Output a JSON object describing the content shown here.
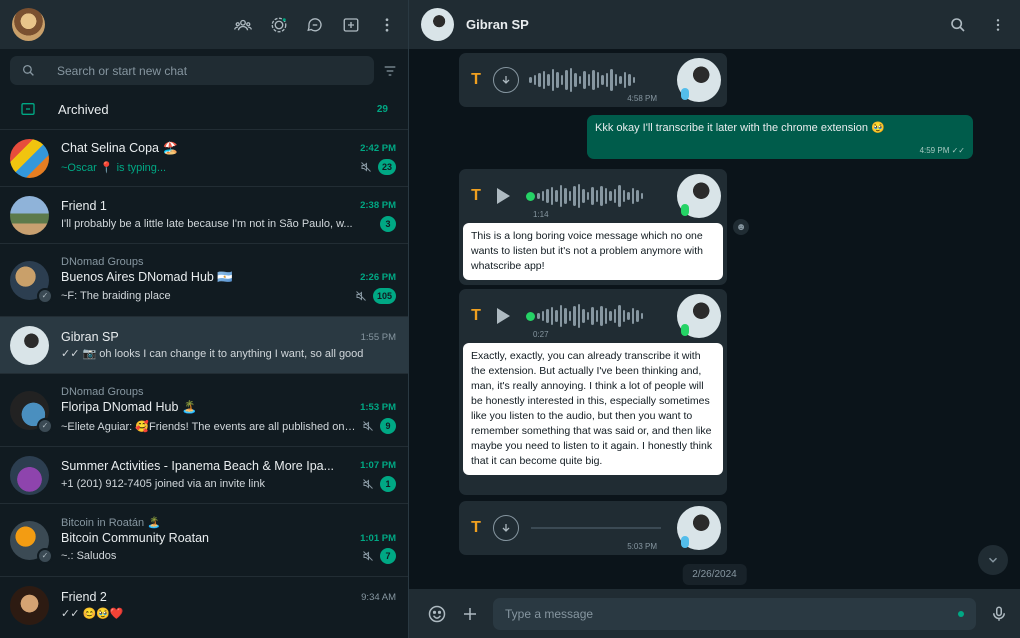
{
  "left_header": {
    "icons": [
      "communities-icon",
      "status-icon",
      "channels-icon",
      "new-chat-icon",
      "menu-icon"
    ]
  },
  "search": {
    "placeholder": "Search or start new chat"
  },
  "archived": {
    "label": "Archived",
    "count": "29"
  },
  "chats": [
    {
      "group": "",
      "name": "Chat Selina Copa 🏖️",
      "time": "2:42 PM",
      "time_green": true,
      "preview": "~Oscar 📍 is typing...",
      "preview_green": true,
      "muted": true,
      "badge": "23"
    },
    {
      "group": "",
      "name": "Friend 1",
      "time": "2:38 PM",
      "time_green": true,
      "preview": "I'll probably be a little late because I'm not in São Paulo, w...",
      "preview_green": false,
      "muted": false,
      "badge": "3"
    },
    {
      "group": "DNomad Groups",
      "name": "Buenos Aires DNomad Hub 🇦🇷",
      "time": "2:26 PM",
      "time_green": true,
      "preview": "~F: The braiding place",
      "preview_green": false,
      "muted": true,
      "badge": "105"
    },
    {
      "group": "",
      "name": "Gibran SP",
      "time": "1:55 PM",
      "time_green": false,
      "preview": "✓✓ 📷 oh looks I can change it to anything I want, so all good",
      "preview_green": false,
      "muted": false,
      "badge": ""
    },
    {
      "group": "DNomad Groups",
      "name": "Floripa DNomad Hub 🏝️",
      "time": "1:53 PM",
      "time_green": true,
      "preview": "~Eliete Aguiar: 🥰Friends!  The events are all published on th...",
      "preview_green": false,
      "muted": true,
      "badge": "9"
    },
    {
      "group": "",
      "name": "Summer Activities - Ipanema Beach & More Ipa...",
      "time": "1:07 PM",
      "time_green": true,
      "preview": "+1 (201) 912-7405 joined via an invite link",
      "preview_green": false,
      "muted": true,
      "badge": "1"
    },
    {
      "group": "Bitcoin in Roatán 🏝️",
      "name": "Bitcoin Community Roatan",
      "time": "1:01 PM",
      "time_green": true,
      "preview": "~.: Saludos",
      "preview_green": false,
      "muted": true,
      "badge": "7"
    },
    {
      "group": "",
      "name": "Friend 2",
      "time": "9:34 AM",
      "time_green": false,
      "preview": "✓✓ 😊🥹❤️",
      "preview_green": false,
      "muted": false,
      "badge": ""
    }
  ],
  "conversation": {
    "title": "Gibran SP",
    "messages": {
      "voice1_time": "4:58 PM",
      "out_text": "Kkk okay I'll transcribe it later with the chrome extension 🥹",
      "out_time": "4:59 PM",
      "voice2_duration": "1:14",
      "voice2_transcript": "This is a long boring voice message which no one wants to listen but it's not a problem anymore with whatscribe app!",
      "voice3_duration": "0:27",
      "voice3_transcript": "Exactly, exactly, you can already transcribe it with the extension. But actually I've been thinking and, man, it's really annoying. I think a lot of people will be honestly interested in this, especially sometimes like you listen to the audio, but then you want to remember something that was said or, and then like maybe you need to listen to it again. I honestly think that it can become quite big.",
      "voice4_time": "5:03 PM"
    },
    "date_pill": "2/26/2024",
    "t_label": "T"
  },
  "composer": {
    "placeholder": "Type a message"
  }
}
